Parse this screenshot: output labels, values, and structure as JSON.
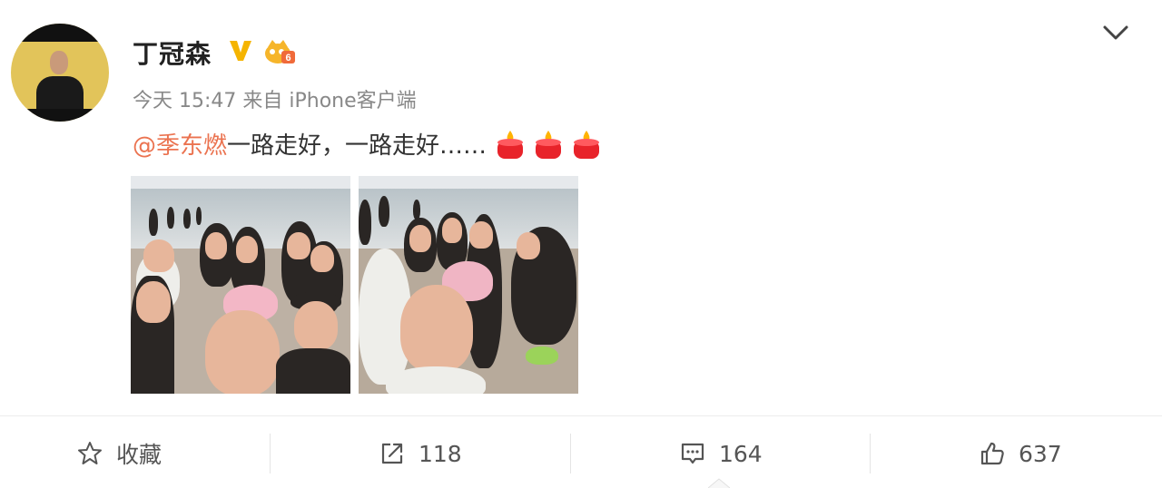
{
  "post": {
    "username": "丁冠森",
    "timestamp": "今天 15:47",
    "source": "来自 iPhone客户端",
    "mention": "@季东燃",
    "text": " 一路走好，一路走好……",
    "verified_icon": "verified-v-badge",
    "vip_icon": "vip-crown-level-6",
    "reaction_emoji": "candle-emoji",
    "reaction_count": 3,
    "vip_level": "6"
  },
  "photos": [
    {
      "description_icon": "group-selfie-beach-photo-1"
    },
    {
      "description_icon": "group-selfie-beach-photo-2"
    }
  ],
  "actions": {
    "favorite_label": "收藏",
    "share_count": "118",
    "comment_count": "164",
    "like_count": "637"
  },
  "colors": {
    "mention": "#eb7350",
    "verified": "#f5b400",
    "candle": "#e8232a",
    "flame": "#ffb300"
  }
}
